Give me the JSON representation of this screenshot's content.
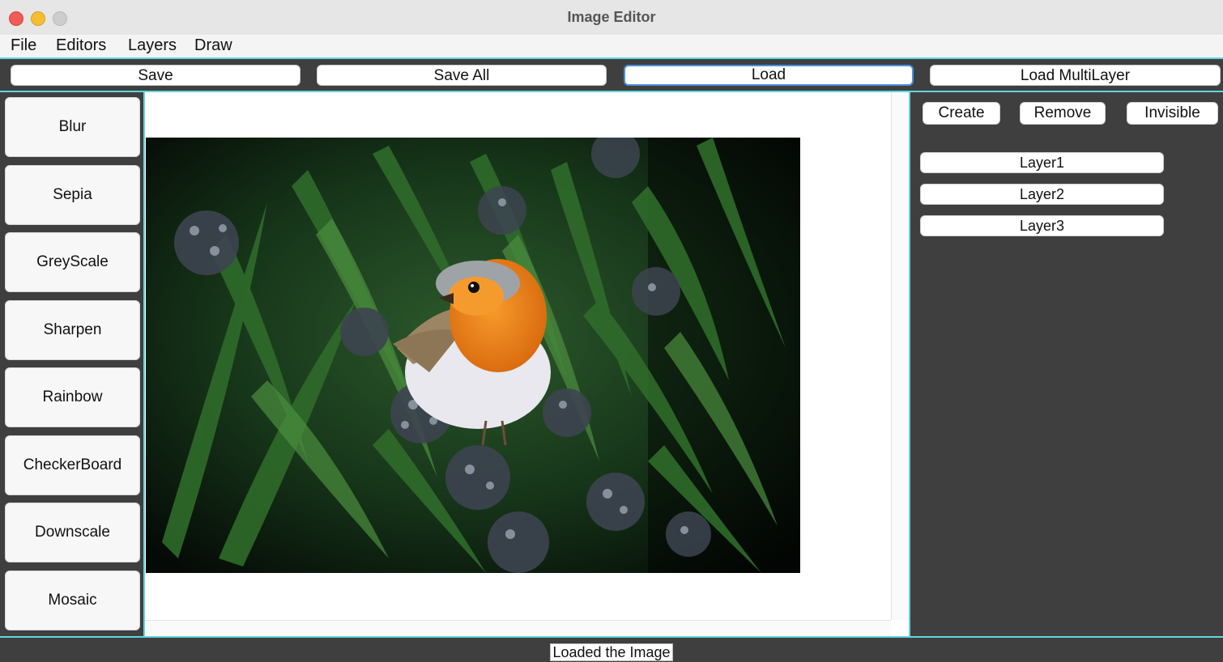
{
  "window": {
    "title": "Image Editor"
  },
  "menu": {
    "items": [
      "File",
      "Editors",
      "Layers",
      "Draw"
    ]
  },
  "toolbar": {
    "buttons": [
      "Save",
      "Save All",
      "Load",
      "Load MultiLayer"
    ],
    "focused": "Load"
  },
  "filters": {
    "buttons": [
      "Blur",
      "Sepia",
      "GreyScale",
      "Sharpen",
      "Rainbow",
      "CheckerBoard",
      "Downscale",
      "Mosaic"
    ]
  },
  "layers_panel": {
    "actions": [
      "Create",
      "Remove",
      "Invisible"
    ],
    "layers": [
      "Layer1",
      "Layer2",
      "Layer3"
    ]
  },
  "canvas": {
    "image_subject": "robin-on-ivy-photo"
  },
  "status": {
    "text": "Loaded the Image"
  },
  "colors": {
    "panel_bg": "#3f3f3f",
    "accent_border": "#5fd6e0",
    "titlebar_bg": "#e6e6e6"
  }
}
